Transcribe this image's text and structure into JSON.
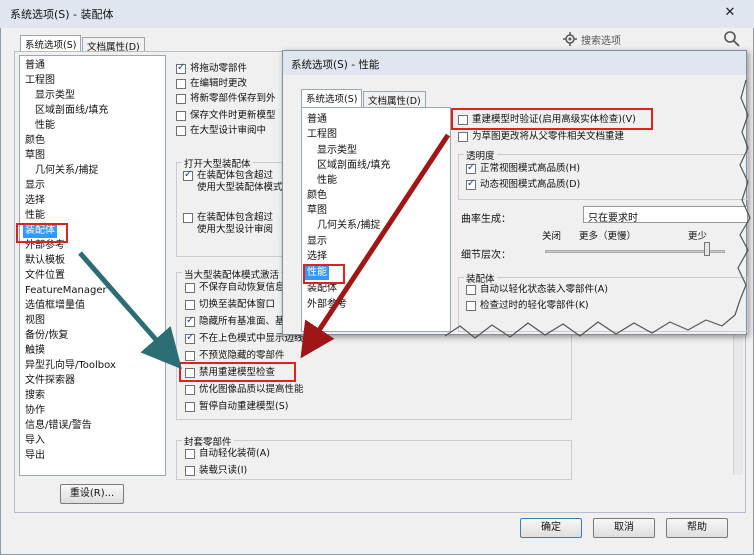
{
  "main": {
    "title": "系统选项(S) - 装配体",
    "close_glyph": "✕",
    "tabs": [
      {
        "label": "系统选项(S)"
      },
      {
        "label": "文档属性(D)"
      }
    ],
    "search_placeholder": "搜索选项",
    "nav": [
      "普通",
      "工程图",
      "显示类型",
      "区域剖面线/填充",
      "性能",
      "颜色",
      "草图",
      "几何关系/捕捉",
      "显示",
      "选择",
      "性能",
      "装配体",
      "外部参考",
      "默认模板",
      "文件位置",
      "FeatureManager",
      "选值框增量值",
      "视图",
      "备份/恢复",
      "触摸",
      "异型孔向导/Toolbox",
      "文件探索器",
      "搜索",
      "协作",
      "信息/错误/警告",
      "导入",
      "导出"
    ],
    "opts_top": [
      "将拖动零部件",
      "在编辑时更改",
      "将新零部件保存到外",
      "保存文件时更新模型",
      "在大型设计审阅中"
    ],
    "group_open_title": "打开大型装配体",
    "group_open": [
      {
        "line1": "在装配体包含超过",
        "line2": "使用大型装配体模式"
      },
      {
        "line1": "在装配体包含超过",
        "line2": "使用大型设计审阅"
      }
    ],
    "group_large_title": "当大型装配体模式激活",
    "group_large": [
      {
        "label": "不保存自动恢复信息",
        "checked": false
      },
      {
        "label": "切换至装配体窗口",
        "checked": false
      },
      {
        "label": "隐藏所有基准面、基准轴、曲线、注解、等等(H)",
        "checked": true
      },
      {
        "label": "不在上色模式中显示边线",
        "checked": true
      },
      {
        "label": "不预览隐藏的零部件",
        "checked": false
      },
      {
        "label": "禁用重建模型检查",
        "checked": false
      },
      {
        "label": "优化图像品质以提高性能",
        "checked": false
      },
      {
        "label": "暂停自动重建模型(S)",
        "checked": false
      }
    ],
    "group_env_title": "封套零部件",
    "group_env": [
      {
        "label": "自动轻化装荷(A)",
        "checked": false
      },
      {
        "label": "装载只读(I)",
        "checked": false
      }
    ],
    "reset_label": "重设(R)...",
    "ok_label": "确定",
    "cancel_label": "取消",
    "help_label": "帮助"
  },
  "popup": {
    "title": "系统选项(S) - 性能",
    "tabs": [
      {
        "label": "系统选项(S)"
      },
      {
        "label": "文档属性(D)"
      }
    ],
    "nav": [
      "普通",
      "工程图",
      "显示类型",
      "区域剖面线/填充",
      "性能",
      "颜色",
      "草图",
      "几何关系/捕捉",
      "显示",
      "选择",
      "性能",
      "装配体",
      "外部参考"
    ],
    "rebuild_label": "重建模型时验证(启用高级实体检查)(V)",
    "rebuild_checked": false,
    "parent_child_label": "为草图更改将从父零件相关文档重建",
    "transparency_title": "透明度",
    "transparency": [
      {
        "label": "正常视图模式高品质(H)",
        "checked": true
      },
      {
        "label": "动态视图模式高品质(D)",
        "checked": true
      }
    ],
    "curvature_label": "曲率生成：",
    "curvature_value": "只在要求时",
    "detail_label": "细节层次：",
    "slider_off": "关闭",
    "slider_more": "更多（更慢）",
    "slider_less": "更少",
    "detail_level": 0.9,
    "assembly_title": "装配体",
    "assembly": [
      {
        "label": "自动以轻化状态装入零部件(A)",
        "checked": false
      },
      {
        "label": "检查过时的轻化零部件(K)",
        "checked": false
      }
    ]
  },
  "colors": {
    "highlight": "#dd2222",
    "arrow_red": "#a01515",
    "arrow_teal": "#2c6e73"
  }
}
